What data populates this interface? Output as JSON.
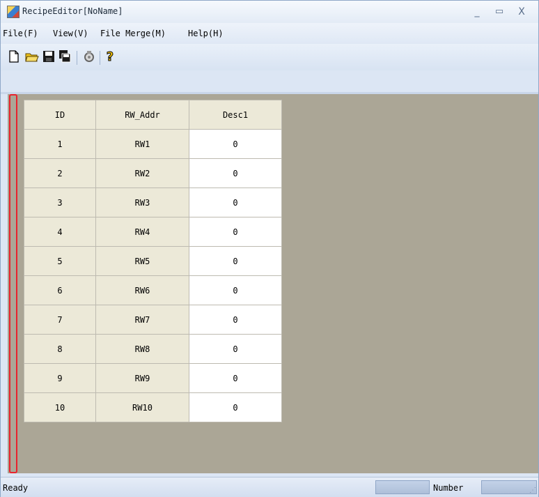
{
  "window": {
    "title": "RecipeEditor[NoName]",
    "minimize": "_",
    "maximize": "▭",
    "close": "X"
  },
  "menu": [
    "File(F)",
    "View(V)",
    "File Merge(M)",
    "Help(H)"
  ],
  "toolbar": {
    "icons": [
      "new-file-icon",
      "open-folder-icon",
      "save-icon",
      "save-as-icon",
      "print-icon",
      "help-icon"
    ],
    "help_glyph": "?"
  },
  "grid": {
    "headers": [
      "ID",
      "RW_Addr",
      "Desc1"
    ],
    "rows": [
      [
        "1",
        "RW1",
        "0"
      ],
      [
        "2",
        "RW2",
        "0"
      ],
      [
        "3",
        "RW3",
        "0"
      ],
      [
        "4",
        "RW4",
        "0"
      ],
      [
        "5",
        "RW5",
        "0"
      ],
      [
        "6",
        "RW6",
        "0"
      ],
      [
        "7",
        "RW7",
        "0"
      ],
      [
        "8",
        "RW8",
        "0"
      ],
      [
        "9",
        "RW9",
        "0"
      ],
      [
        "10",
        "RW10",
        "0"
      ]
    ]
  },
  "status": {
    "ready": "Ready",
    "number": "Number"
  },
  "colors": {
    "highlight": "#e8232d",
    "content_bg": "#aba696",
    "header_bg": "#ece9d8"
  }
}
